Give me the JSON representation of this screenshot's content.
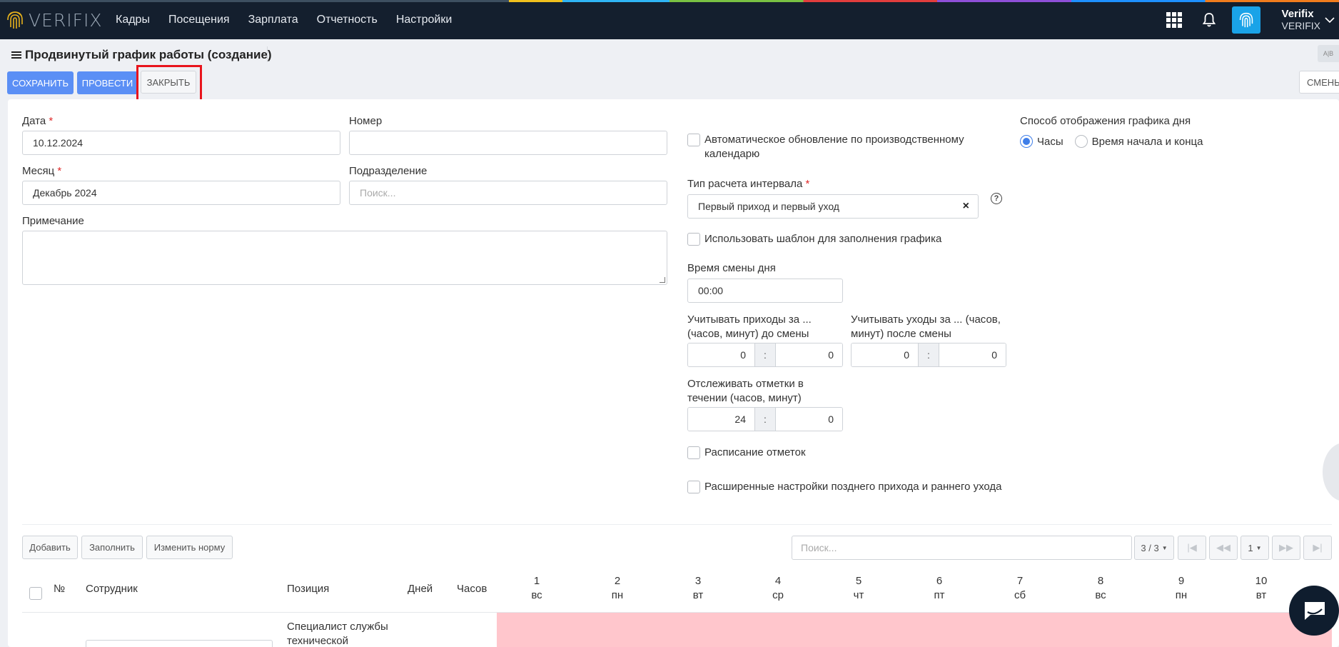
{
  "topbar": {
    "logo_text": "VERIFIX",
    "nav": [
      "Кадры",
      "Посещения",
      "Зарплата",
      "Отчетность",
      "Настройки"
    ],
    "user_name": "Verifix",
    "user_org": "VERIFIX"
  },
  "page": {
    "title": "Продвинутый график работы (создание)",
    "corner_label": "A|B"
  },
  "actions": {
    "save": "СОХРАНИТЬ",
    "post": "ПРОВЕСТИ",
    "close": "ЗАКРЫТЬ",
    "shifts": "СМЕНЫ"
  },
  "form": {
    "date_label": "Дата",
    "date_value": "10.12.2024",
    "number_label": "Номер",
    "number_value": "",
    "month_label": "Месяц",
    "month_value": "Декабрь 2024",
    "division_label": "Подразделение",
    "division_placeholder": "Поиск...",
    "note_label": "Примечание",
    "auto_update_label": "Автоматическое обновление по производственному календарю",
    "interval_type_label": "Тип расчета интервала",
    "interval_type_value": "Первый приход и первый уход",
    "use_template_label": "Использовать шаблон для заполнения графика",
    "shift_time_label": "Время смены дня",
    "shift_time_value": "00:00",
    "arrivals_label": "Учитывать приходы за ... (часов, минут) до смены",
    "arrivals_h": "0",
    "arrivals_m": "0",
    "departures_label": "Учитывать уходы за ... (часов, минут) после смены",
    "departures_h": "0",
    "departures_m": "0",
    "track_label": "Отслеживать отметки в течении (часов, минут)",
    "track_h": "24",
    "track_m": "0",
    "marks_schedule_label": "Расписание отметок",
    "advanced_label": "Расширенные настройки позднего прихода и раннего ухода",
    "display_mode_label": "Способ отображения графика дня",
    "display_hours": "Часы",
    "display_start_end": "Время начала и конца",
    "colon": ":",
    "required_mark": "*",
    "help_icon": "question-circle-icon",
    "clear_icon": "×"
  },
  "table_toolbar": {
    "add": "Добавить",
    "fill": "Заполнить",
    "change_norm": "Изменить норму",
    "search_placeholder": "Поиск...",
    "page_size": "3 / 3",
    "page": "1"
  },
  "table": {
    "headers": {
      "num": "№",
      "employee": "Сотрудник",
      "position": "Позиция",
      "days": "Дней",
      "hours": "Часов"
    },
    "days": [
      {
        "n": "1",
        "d": "вс"
      },
      {
        "n": "2",
        "d": "пн"
      },
      {
        "n": "3",
        "d": "вт"
      },
      {
        "n": "4",
        "d": "ср"
      },
      {
        "n": "5",
        "d": "чт"
      },
      {
        "n": "6",
        "d": "пт"
      },
      {
        "n": "7",
        "d": "сб"
      },
      {
        "n": "8",
        "d": "вс"
      },
      {
        "n": "9",
        "d": "пн"
      },
      {
        "n": "10",
        "d": "вт"
      }
    ],
    "row1_position": "Специалист службы технической"
  },
  "colors": {
    "topbar": "#141f2e",
    "primary": "#5b8ff5",
    "highlight": "#e8141c",
    "row_pink": "#ffc6cc"
  }
}
